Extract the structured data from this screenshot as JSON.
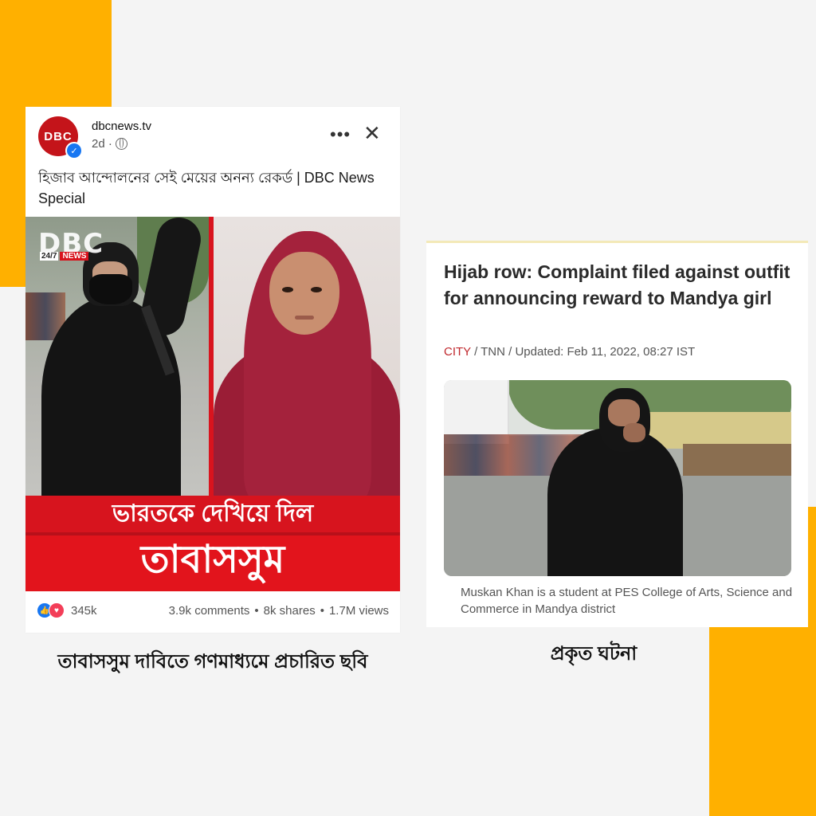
{
  "colors": {
    "accent": "#ffb000",
    "banner_red": "#e2141c",
    "fb_blue": "#1877f2",
    "link_red": "#c0282d"
  },
  "fb_post": {
    "avatar_text": "DBC",
    "page_name": "dbcnews.tv",
    "time": "2d ·",
    "more_icon": "more-horizontal-icon",
    "close_icon": "close-icon",
    "caption": "হিজাব আন্দোলনের সেই মেয়ের অনন্য রেকর্ড | DBC News Special",
    "watermark": "DBC",
    "watermark_live": "24/7",
    "watermark_news": "NEWS",
    "banner_line1": "ভারতকে দেখিয়ে দিল",
    "banner_line2": "তাবাসসুম",
    "reactions_count": "345k",
    "comments": "3.9k comments",
    "shares": "8k shares",
    "views": "1.7M views",
    "sep": "•"
  },
  "left_label": "তাবাসসুম দাবিতে গণমাধ্যমে প্রচারিত ছবি",
  "news_article": {
    "headline": "Hijab row: Complaint filed against outfit for announcing reward to Mandya girl",
    "category": "CITY",
    "byline_rest": " / TNN / Updated: Feb 11, 2022, 08:27 IST",
    "photo_caption": "Muskan Khan is a student at PES College of Arts, Science and Commerce in Mandya district"
  },
  "right_label": "প্রকৃত ঘটনা"
}
